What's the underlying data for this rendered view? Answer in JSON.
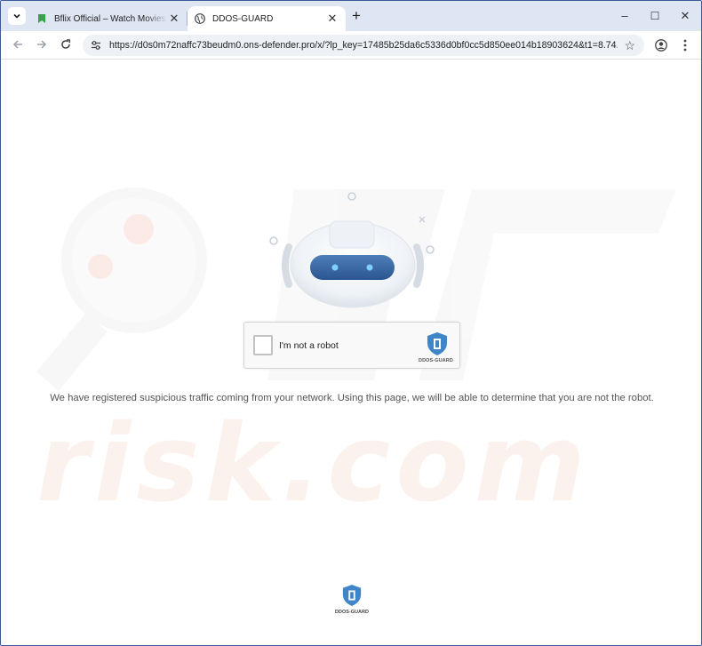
{
  "browser": {
    "tabs": [
      {
        "title": "Bflix Official – Watch Movies and TV Shows Online",
        "active": false,
        "favicon": "bookmark-green-icon"
      },
      {
        "title": "DDOS-GUARD",
        "active": true,
        "favicon": "globe-icon"
      }
    ],
    "new_tab_label": "+",
    "address": {
      "url": "https://d0s0m72naffc73beudm0.ons-defender.pro/x/?lp_key=17485b25da6c5336d0bf0cc5d850ee014b18903624&t1=8.74..."
    },
    "window_controls": {
      "minimize": "–",
      "maximize": "☐",
      "close": "✕"
    }
  },
  "page": {
    "captcha": {
      "label": "I'm not a robot",
      "brand": "DDOS-GUARD",
      "checked": false
    },
    "message": "We have registered suspicious traffic coming from your network. Using this page, we will be able to determine that you are not the robot.",
    "footer_brand": "DDOS-GUARD"
  },
  "colors": {
    "brand_blue": "#3f86c8",
    "tabstrip_bg": "#dfe6f3",
    "omnibox_bg": "#eef1f6",
    "watermark": "#f6e4d8"
  }
}
